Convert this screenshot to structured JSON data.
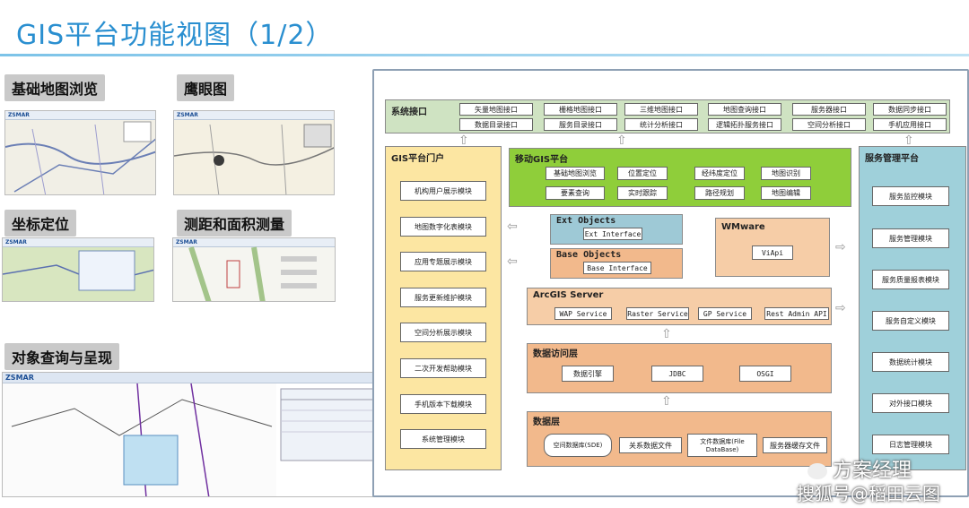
{
  "title": "GIS平台功能视图（1/2）",
  "features": {
    "f1": "基础地图浏览",
    "f2": "鹰眼图",
    "f3": "坐标定位",
    "f4": "测距和面积测量",
    "f5": "对象查询与呈现"
  },
  "thumb_logo": "ZSMAR",
  "diagram": {
    "interface": {
      "label": "系统接口",
      "items": [
        "矢量地图接口",
        "栅格地图接口",
        "三维地图接口",
        "地图查询接口",
        "服务器接口",
        "数据同步接口",
        "数据目录接口",
        "服务目录接口",
        "统计分析接口",
        "逻辑拓扑服务接口",
        "空间分析接口",
        "手机应用接口"
      ]
    },
    "portal": {
      "label": "GIS平台门户",
      "items": [
        "机构用户展示模块",
        "地图数字化表模块",
        "应用专题展示模块",
        "服务更新维护模块",
        "空间分析展示模块",
        "二次开发帮助模块",
        "手机版本下载模块",
        "系统管理模块"
      ]
    },
    "mobile": {
      "label": "移动GIS平台",
      "items": [
        "基础地图浏览",
        "位置定位",
        "经纬度定位",
        "地图识别",
        "要素查询",
        "实时跟踪",
        "路径规划",
        "地图编辑"
      ]
    },
    "ext": {
      "label": "Ext Objects",
      "item": "Ext Interface"
    },
    "base": {
      "label": "Base Objects",
      "item": "Base Interface"
    },
    "wmware": {
      "label": "WMware",
      "item": "ViApi"
    },
    "arcgis": {
      "label": "ArcGIS Server",
      "items": [
        "WAP Service",
        "Raster Service",
        "GP Service",
        "Rest Admin API"
      ]
    },
    "access": {
      "label": "数据访问层",
      "items": [
        "数据引擎",
        "JDBC",
        "OSGI"
      ]
    },
    "data": {
      "label": "数据层",
      "items": [
        "空间数据库(SDE)",
        "关系数据文件",
        "文件数据库(File DataBase)",
        "服务器缓存文件"
      ]
    },
    "mgmt": {
      "label": "服务管理平台",
      "items": [
        "服务监控模块",
        "服务管理模块",
        "服务质量报表模块",
        "服务自定义模块",
        "数据统计模块",
        "对外接口模块",
        "日志管理模块"
      ]
    }
  },
  "watermark": {
    "line1": "方案经理",
    "line2": "搜狐号@稻田云图"
  },
  "colors": {
    "title": "#2a8fd0",
    "interface_bg": "#cfe3c2",
    "portal_bg": "#fce6a2",
    "mobile_bg": "#8fce3a",
    "ext_bg": "#9ec9d6",
    "base_bg": "#f2b98c",
    "wmware_bg": "#f6cda7",
    "mgmt_bg": "#9fd0da"
  }
}
